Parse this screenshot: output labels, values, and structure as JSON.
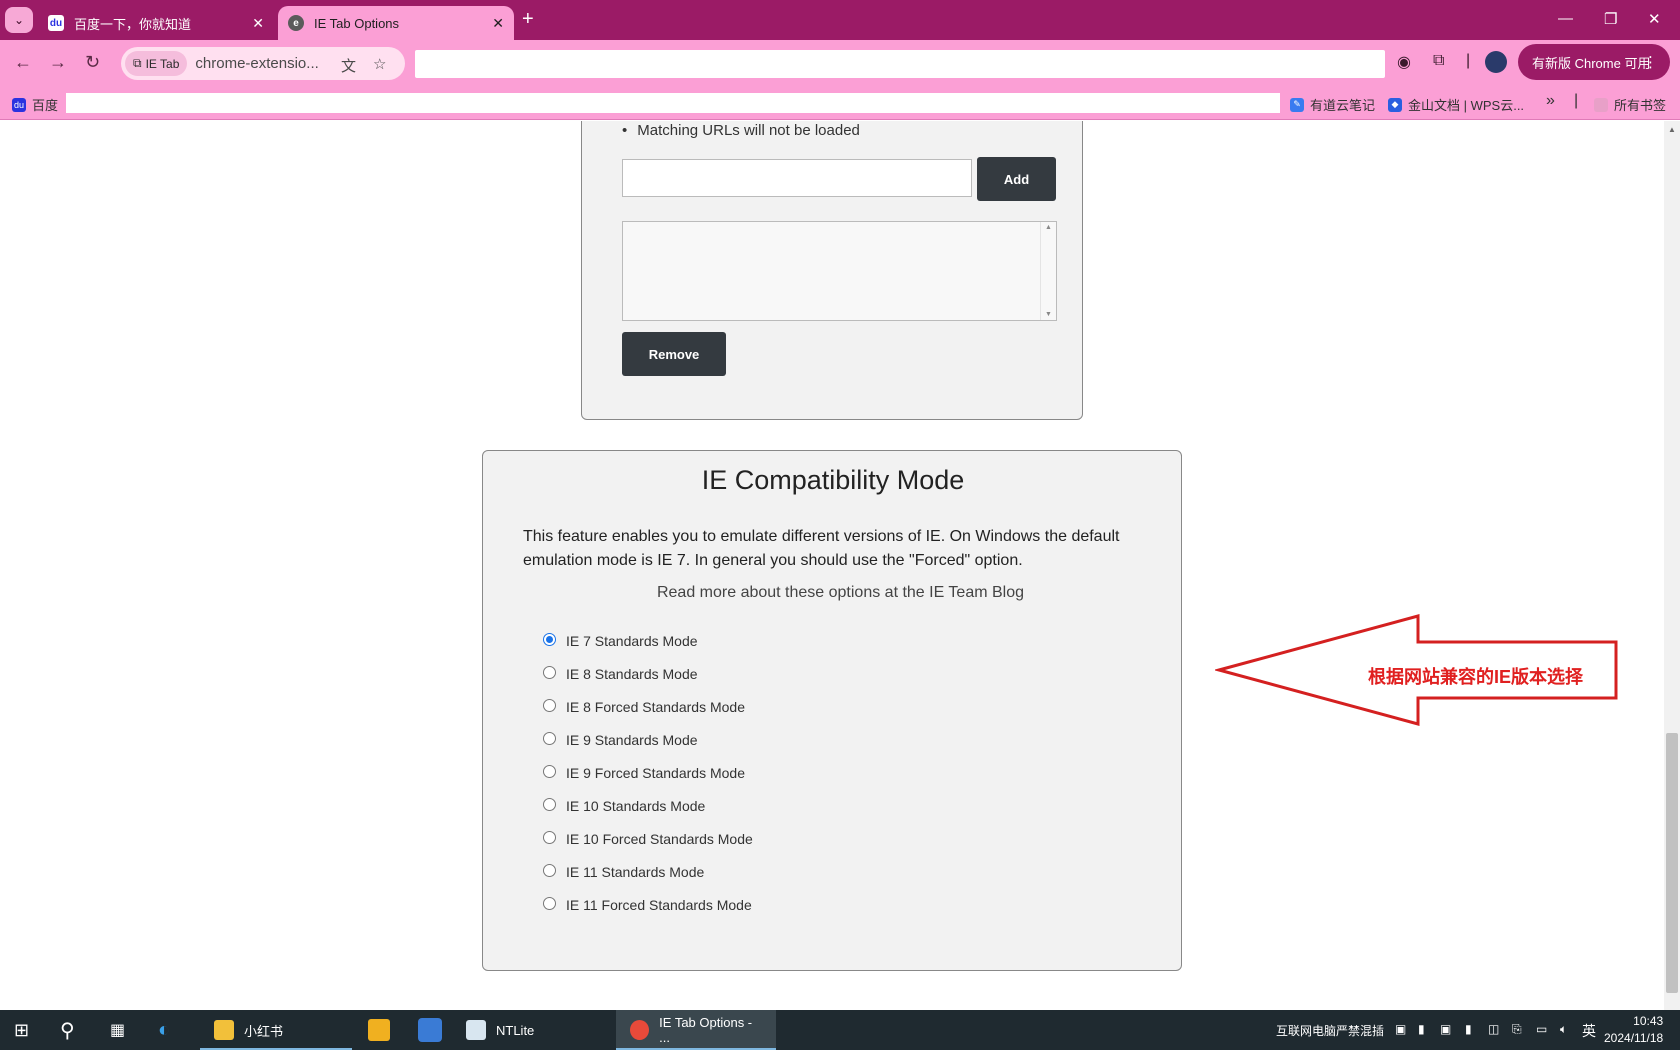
{
  "browser": {
    "tabs": [
      {
        "title": "百度一下，你就知道",
        "active": false
      },
      {
        "title": "IE Tab Options",
        "active": true
      }
    ],
    "omnibox": {
      "chip_label": "IE Tab",
      "url_text": "chrome-extensio..."
    },
    "update_button_label": "有新版 Chrome 可用",
    "bookmarks": {
      "left_item": "百度",
      "items": [
        "有道云笔记",
        "金山文档 | WPS云..."
      ],
      "all_bookmarks": "所有书签"
    }
  },
  "exclusion": {
    "bullet": "Matching URLs will not be loaded",
    "url_input_value": "",
    "add_label": "Add",
    "remove_label": "Remove"
  },
  "compat": {
    "title": "IE Compatibility Mode",
    "description": "This feature enables you to emulate different versions of IE. On Windows the default emulation mode is IE 7. In general you should use the \"Forced\" option.",
    "read_more": "Read more about these options at the IE Team Blog",
    "selected_index": 0,
    "options": [
      "IE 7 Standards Mode",
      "IE 8 Standards Mode",
      "IE 8 Forced Standards Mode",
      "IE 9 Standards Mode",
      "IE 9 Forced Standards Mode",
      "IE 10 Standards Mode",
      "IE 10 Forced Standards Mode",
      "IE 11 Standards Mode",
      "IE 11 Forced Standards Mode"
    ]
  },
  "annotation": {
    "text": "根据网站兼容的IE版本选择",
    "color": "#e02020"
  },
  "taskbar": {
    "apps": [
      "小红书",
      "NTLite",
      "IE Tab Options - ..."
    ],
    "tray_text": "互联网电脑严禁混插",
    "ime": "英",
    "time": "10:43",
    "date": "2024/11/18"
  }
}
